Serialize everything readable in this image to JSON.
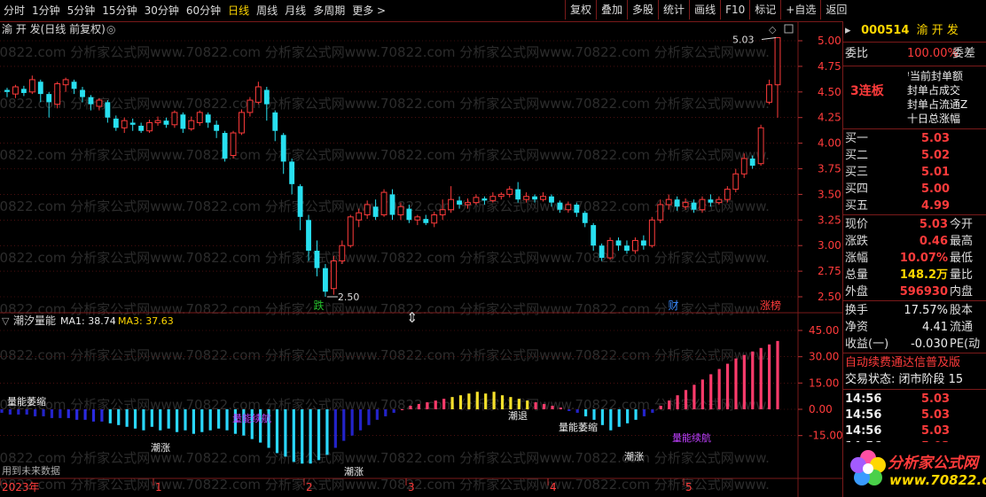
{
  "toolbar": {
    "left": [
      "分时",
      "1分钟",
      "5分钟",
      "15分钟",
      "30分钟",
      "60分钟",
      "日线",
      "周线",
      "月线",
      "多周期",
      "更多 >"
    ],
    "active_index": 6,
    "right": [
      "复权",
      "叠加",
      "多股",
      "统计",
      "画线",
      "F10",
      "标记",
      "+自选",
      "返回"
    ]
  },
  "chart": {
    "title": "渝 开 发(日线 前复权)",
    "price_ticks": [
      "5.00",
      "4.75",
      "4.50",
      "4.25",
      "4.00",
      "3.75",
      "3.50",
      "3.25",
      "3.00",
      "2.75",
      "2.50"
    ],
    "high_label": "5.03",
    "low_label": "2.50",
    "markers": [
      {
        "text": "跌",
        "color": "#27c22d"
      },
      {
        "text": "财",
        "color": "#3a8bff"
      },
      {
        "text": "涨榜",
        "color": "#ff3b3b"
      }
    ],
    "candles": [
      [
        4.52,
        4.5,
        4.54,
        4.45
      ],
      [
        4.48,
        4.55,
        4.57,
        4.44
      ],
      [
        4.53,
        4.49,
        4.56,
        4.46
      ],
      [
        4.5,
        4.62,
        4.66,
        4.48
      ],
      [
        4.6,
        4.48,
        4.62,
        4.4
      ],
      [
        4.48,
        4.4,
        4.5,
        4.25
      ],
      [
        4.38,
        4.58,
        4.6,
        4.34
      ],
      [
        4.57,
        4.62,
        4.64,
        4.5
      ],
      [
        4.6,
        4.53,
        4.62,
        4.48
      ],
      [
        4.52,
        4.45,
        4.55,
        4.4
      ],
      [
        4.45,
        4.38,
        4.47,
        4.32
      ],
      [
        4.36,
        4.42,
        4.44,
        4.32
      ],
      [
        4.4,
        4.25,
        4.42,
        4.2
      ],
      [
        4.24,
        4.15,
        4.27,
        4.12
      ],
      [
        4.15,
        4.22,
        4.25,
        4.1
      ],
      [
        4.2,
        4.18,
        4.24,
        4.12
      ],
      [
        4.17,
        4.12,
        4.2,
        4.1
      ],
      [
        4.12,
        4.2,
        4.23,
        4.1
      ],
      [
        4.2,
        4.22,
        4.26,
        4.17
      ],
      [
        4.22,
        4.18,
        4.25,
        4.15
      ],
      [
        4.18,
        4.3,
        4.32,
        4.15
      ],
      [
        4.28,
        4.14,
        4.3,
        4.1
      ],
      [
        4.14,
        4.22,
        4.26,
        4.12
      ],
      [
        4.2,
        4.3,
        4.32,
        4.17
      ],
      [
        4.28,
        4.2,
        4.3,
        4.15
      ],
      [
        4.18,
        4.12,
        4.22,
        4.05
      ],
      [
        4.1,
        3.85,
        4.12,
        3.82
      ],
      [
        3.88,
        4.1,
        4.12,
        3.85
      ],
      [
        4.1,
        4.3,
        4.33,
        4.08
      ],
      [
        4.3,
        4.42,
        4.45,
        4.26
      ],
      [
        4.4,
        4.55,
        4.6,
        4.38
      ],
      [
        4.52,
        4.38,
        4.55,
        4.22
      ],
      [
        4.3,
        4.12,
        4.32,
        4.02
      ],
      [
        4.08,
        3.82,
        4.1,
        3.7
      ],
      [
        3.82,
        3.6,
        3.85,
        3.5
      ],
      [
        3.58,
        3.28,
        3.6,
        3.15
      ],
      [
        3.25,
        2.95,
        3.3,
        2.85
      ],
      [
        2.95,
        2.78,
        3.05,
        2.7
      ],
      [
        2.78,
        2.55,
        2.82,
        2.5
      ],
      [
        2.58,
        2.85,
        2.9,
        2.52
      ],
      [
        2.85,
        3.0,
        3.05,
        2.82
      ],
      [
        3.0,
        3.28,
        3.3,
        2.98
      ],
      [
        3.25,
        3.32,
        3.36,
        3.18
      ],
      [
        3.3,
        3.4,
        3.44,
        3.26
      ],
      [
        3.38,
        3.28,
        3.45,
        3.25
      ],
      [
        3.3,
        3.52,
        3.55,
        3.28
      ],
      [
        3.5,
        3.3,
        3.55,
        3.25
      ],
      [
        3.3,
        3.38,
        3.42,
        3.25
      ],
      [
        3.36,
        3.25,
        3.4,
        3.22
      ],
      [
        3.25,
        3.28,
        3.3,
        3.2
      ],
      [
        3.26,
        3.22,
        3.3,
        3.2
      ],
      [
        3.22,
        3.3,
        3.33,
        3.18
      ],
      [
        3.3,
        3.35,
        3.45,
        3.25
      ],
      [
        3.35,
        3.45,
        3.58,
        3.32
      ],
      [
        3.44,
        3.4,
        3.48,
        3.36
      ],
      [
        3.4,
        3.42,
        3.46,
        3.36
      ],
      [
        3.42,
        3.47,
        3.5,
        3.4
      ],
      [
        3.46,
        3.44,
        3.48,
        3.4
      ],
      [
        3.44,
        3.48,
        3.52,
        3.42
      ],
      [
        3.48,
        3.5,
        3.52,
        3.45
      ],
      [
        3.5,
        3.55,
        3.58,
        3.47
      ],
      [
        3.55,
        3.45,
        3.62,
        3.42
      ],
      [
        3.45,
        3.48,
        3.52,
        3.42
      ],
      [
        3.48,
        3.45,
        3.5,
        3.42
      ],
      [
        3.45,
        3.48,
        3.52,
        3.43
      ],
      [
        3.48,
        3.42,
        3.5,
        3.38
      ],
      [
        3.42,
        3.35,
        3.44,
        3.32
      ],
      [
        3.35,
        3.4,
        3.43,
        3.32
      ],
      [
        3.4,
        3.32,
        3.42,
        3.28
      ],
      [
        3.32,
        3.22,
        3.34,
        3.18
      ],
      [
        3.2,
        3.0,
        3.22,
        2.95
      ],
      [
        3.0,
        2.88,
        3.02,
        2.85
      ],
      [
        2.88,
        3.05,
        3.08,
        2.86
      ],
      [
        3.05,
        3.0,
        3.08,
        2.95
      ],
      [
        3.0,
        2.95,
        3.05,
        2.92
      ],
      [
        2.95,
        3.05,
        3.08,
        2.92
      ],
      [
        3.05,
        3.0,
        3.1,
        2.96
      ],
      [
        3.0,
        3.25,
        3.28,
        2.98
      ],
      [
        3.25,
        3.4,
        3.45,
        3.22
      ],
      [
        3.4,
        3.45,
        3.5,
        3.35
      ],
      [
        3.45,
        3.38,
        3.48,
        3.34
      ],
      [
        3.38,
        3.42,
        3.46,
        3.35
      ],
      [
        3.42,
        3.35,
        3.45,
        3.32
      ],
      [
        3.35,
        3.45,
        3.48,
        3.32
      ],
      [
        3.45,
        3.42,
        3.5,
        3.38
      ],
      [
        3.42,
        3.45,
        3.48,
        3.4
      ],
      [
        3.45,
        3.55,
        3.58,
        3.42
      ],
      [
        3.55,
        3.7,
        3.75,
        3.52
      ],
      [
        3.7,
        3.85,
        3.9,
        3.66
      ],
      [
        3.85,
        3.78,
        3.88,
        3.75
      ],
      [
        3.8,
        4.15,
        4.18,
        3.78
      ],
      [
        4.4,
        4.57,
        4.62,
        4.38
      ],
      [
        4.57,
        5.03,
        5.03,
        4.25
      ]
    ],
    "osc_title": "潮汐量能",
    "ma1_label": "MA1: 38.74",
    "ma3_label": "MA3: 37.63",
    "osc_ticks": [
      "45.00",
      "30.00",
      "15.00",
      "0.00",
      "-15.00"
    ],
    "osc_values": [
      -2,
      -3,
      -3,
      -3,
      -4,
      -4,
      -5,
      -5,
      -5,
      -6,
      -6,
      -7,
      -7,
      -8,
      -9,
      -10,
      -11,
      -12,
      -10,
      -12,
      -11,
      -13,
      -12,
      -14,
      -13,
      -12,
      -11,
      -12,
      -14,
      -15,
      -17,
      -19,
      -22,
      -25,
      -27,
      -30,
      -31,
      -31,
      -29,
      -26,
      -22,
      -18,
      -15,
      -12,
      -9,
      -6,
      -4,
      -2,
      0,
      2,
      3,
      4,
      5,
      6,
      7,
      8,
      9,
      10,
      9,
      10,
      8,
      7,
      6,
      5,
      4,
      3,
      2,
      1,
      -1,
      -2,
      -4,
      -6,
      -9,
      -12,
      -10,
      -8,
      -6,
      -4,
      -2,
      2,
      5,
      8,
      11,
      14,
      17,
      20,
      23,
      26,
      29,
      31,
      33,
      35,
      37,
      39
    ],
    "osc_labels": [
      "量能萎缩",
      "潮涨",
      "量能续航",
      "潮退",
      "量能萎缩",
      "潮涨",
      "量能续航"
    ],
    "footer_note": "用到未来数据",
    "date_labels": [
      "2023年",
      "1",
      "2",
      "3",
      "4",
      "5"
    ]
  },
  "panel": {
    "code": "000514",
    "name": "渝 开 发",
    "weibi_label": "委比",
    "weibi_value": "100.00%",
    "weicha_label": "委差",
    "lianban": "3连板",
    "seal_items": [
      "当前封单额",
      "封单占成交",
      "封单占流通Z",
      "十日总涨幅"
    ],
    "buy": [
      {
        "label": "买一",
        "price": "5.03"
      },
      {
        "label": "买二",
        "price": "5.02"
      },
      {
        "label": "买三",
        "price": "5.01"
      },
      {
        "label": "买四",
        "price": "5.00"
      },
      {
        "label": "买五",
        "price": "4.99"
      }
    ],
    "quote": [
      {
        "label": "现价",
        "value": "5.03",
        "value_color": "#ff3b3b",
        "right": "今开"
      },
      {
        "label": "涨跌",
        "value": "0.46",
        "value_color": "#ff3b3b",
        "right": "最高"
      },
      {
        "label": "涨幅",
        "value": "10.07%",
        "value_color": "#ff3b3b",
        "right": "最低"
      },
      {
        "label": "总量",
        "value": "148.2万",
        "value_color": "#ffd700",
        "right": "量比"
      },
      {
        "label": "外盘",
        "value": "596930",
        "value_color": "#ff3b3b",
        "right": "内盘"
      }
    ],
    "fund": [
      {
        "label": "换手",
        "value": "17.57%",
        "right": "股本"
      },
      {
        "label": "净资",
        "value": "4.41",
        "right": "流通"
      },
      {
        "label": "收益(一)",
        "value": "-0.030",
        "right": "PE(动"
      }
    ],
    "notice": "自动续费通达信普及版",
    "trade_state": "交易状态: 闭市阶段 15",
    "ticks": [
      {
        "time": "14:56",
        "price": "5.03"
      },
      {
        "time": "14:56",
        "price": "5.03"
      },
      {
        "time": "14:56",
        "price": "5.03"
      },
      {
        "time": "14:56",
        "price": "5.03"
      }
    ],
    "logo_text": "分析家公式网",
    "logo_url": "www.70822.com"
  },
  "watermark": "70822.com 分析家公式网www.70822.com 分析家公式网www.70822.com 分析家公式网www.70822.com 分析家公式网www."
}
